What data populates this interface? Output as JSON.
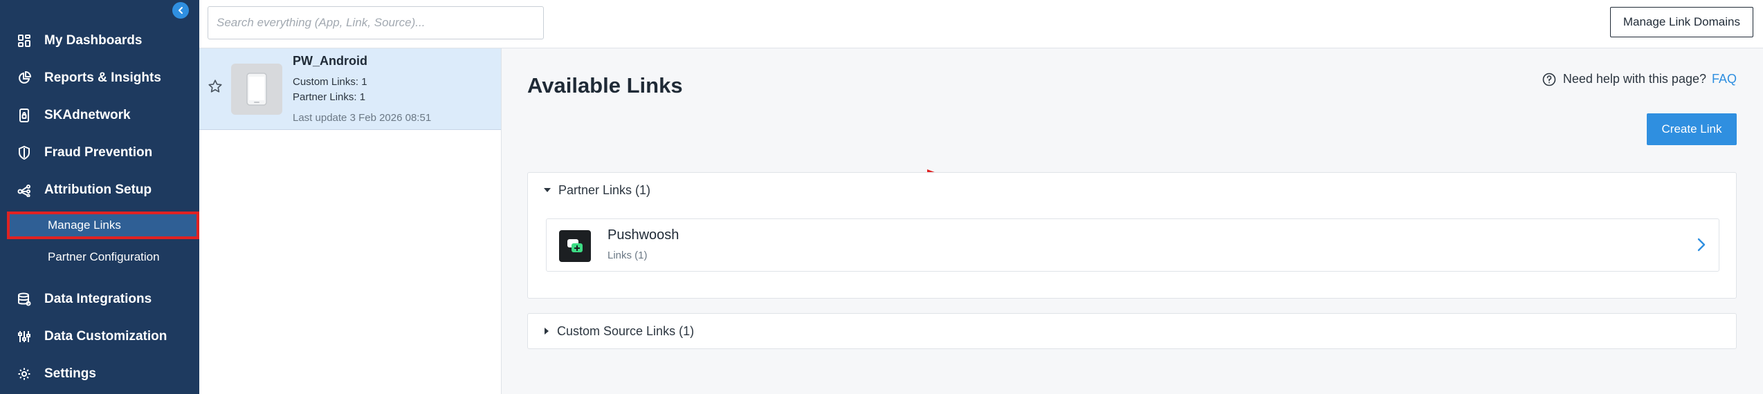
{
  "sidebar": {
    "items": [
      {
        "label": "My Dashboards",
        "icon": "dashboard-grid-icon"
      },
      {
        "label": "Reports & Insights",
        "icon": "pie-chart-icon"
      },
      {
        "label": "SKAdnetwork",
        "icon": "phone-lock-icon"
      },
      {
        "label": "Fraud Prevention",
        "icon": "shield-icon"
      },
      {
        "label": "Attribution Setup",
        "icon": "attribution-nodes-icon"
      },
      {
        "label": "Data Integrations",
        "icon": "database-icon"
      },
      {
        "label": "Data Customization",
        "icon": "sliders-icon"
      },
      {
        "label": "Settings",
        "icon": "gear-icon"
      }
    ],
    "sub_items": [
      {
        "label": "Manage Links",
        "active": true
      },
      {
        "label": "Partner Configuration",
        "active": false
      }
    ],
    "accent_color": "#1e3a5f",
    "highlight_color": "#e02222"
  },
  "topbar": {
    "search_placeholder": "Search everything (App, Link, Source)...",
    "manage_domains_label": "Manage Link Domains"
  },
  "app": {
    "name": "PW_Android",
    "custom_links": "Custom Links: 1",
    "partner_links": "Partner Links: 1",
    "last_update": "Last update 3 Feb 2026 08:51"
  },
  "main": {
    "title": "Available Links",
    "help_text": "Need help with this page?",
    "faq_label": "FAQ",
    "create_link_label": "Create Link",
    "partner_section": {
      "header": "Partner Links (1)",
      "partners": [
        {
          "name": "Pushwoosh",
          "sub": "Links (1)"
        }
      ]
    },
    "custom_section": {
      "header": "Custom Source Links (1)"
    },
    "primary_color": "#2f8fe0"
  }
}
